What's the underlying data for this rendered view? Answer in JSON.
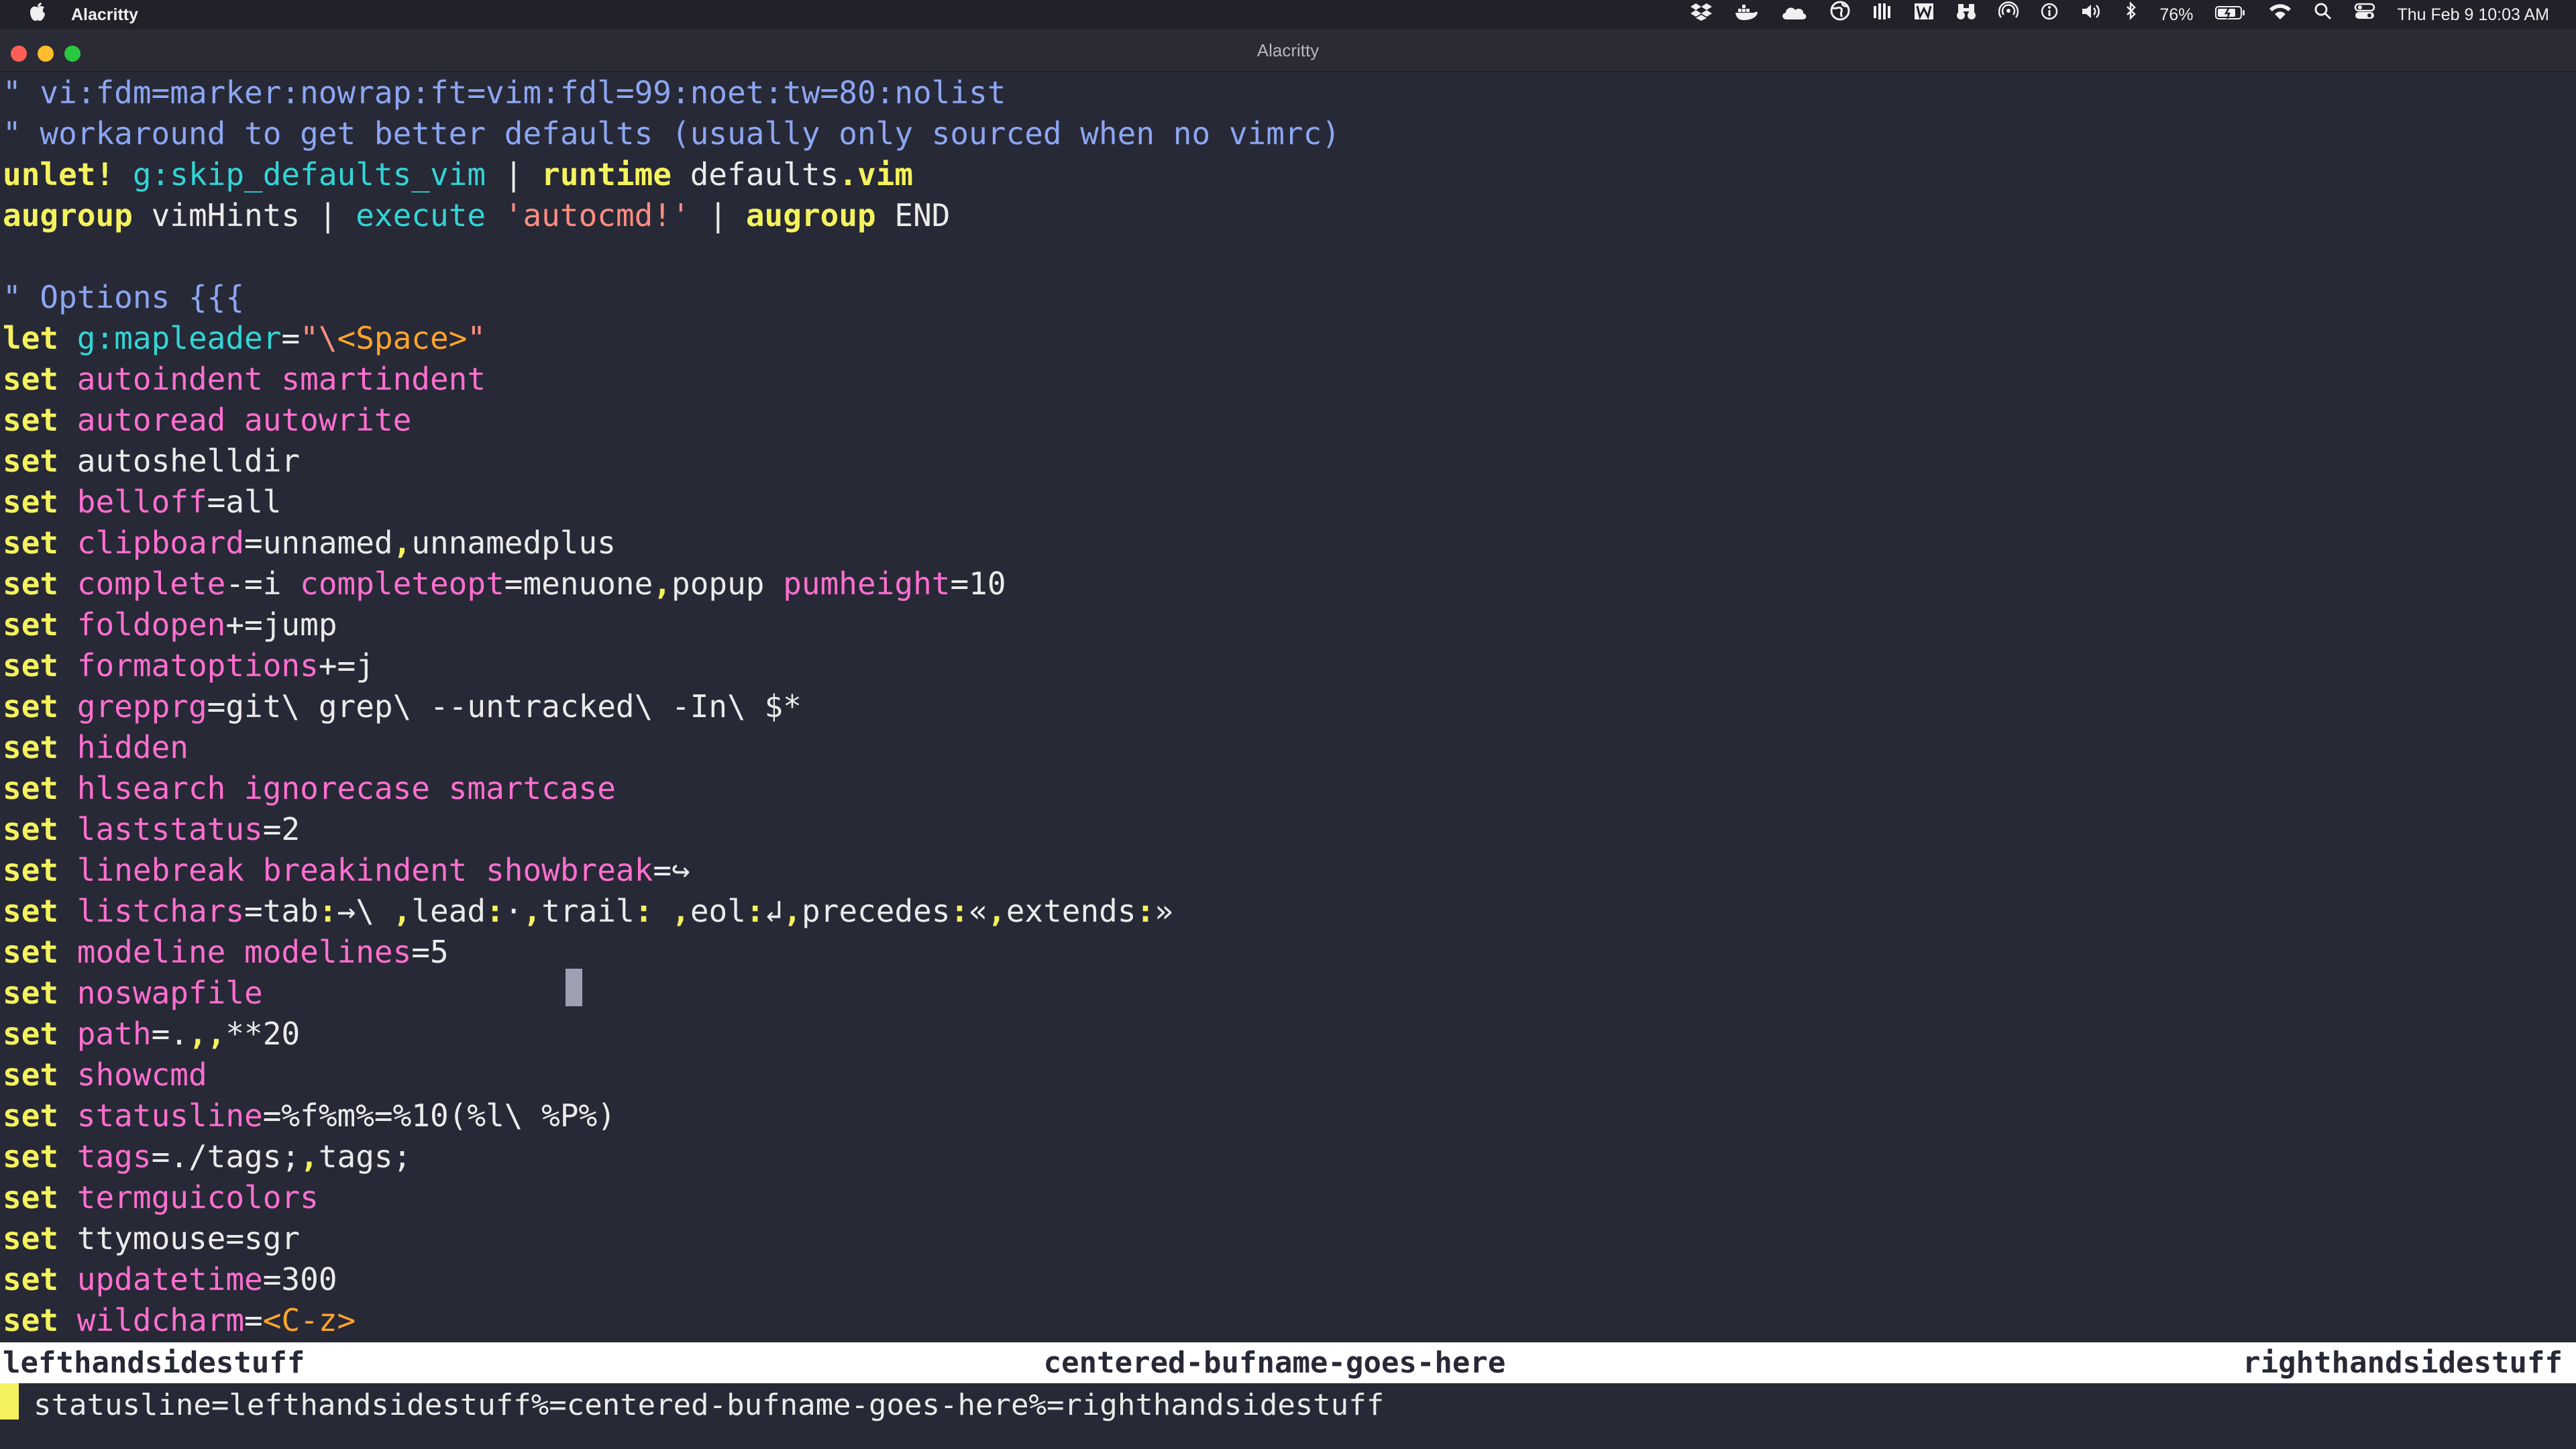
{
  "menubar": {
    "app": "Alacritty",
    "icons": [
      "apple-icon",
      "dropbox-icon",
      "docker-icon",
      "cloud-icon",
      "globe-icon",
      "bars-icon",
      "w-icon",
      "binoculars-icon",
      "airdrop-icon",
      "info-icon",
      "volume-icon",
      "bluetooth-icon",
      "battery-icon",
      "wifi-icon",
      "search-icon",
      "control-center-icon"
    ],
    "battery": "76%",
    "datetime": "Thu Feb 9  10:03 AM"
  },
  "window": {
    "title": "Alacritty"
  },
  "editor": {
    "lines": {
      "l1": "\" vi:fdm=marker:nowrap:ft=vim:fdl=99:noet:tw=80:nolist",
      "l2": "\" workaround to get better defaults (usually only sourced when no vimrc)",
      "l3": {
        "a": "unlet!",
        "b": " ",
        "c": "g:skip_defaults_vim",
        "d": " | ",
        "e": "runtime",
        "f": " defaults",
        "g": ".vim"
      },
      "l4": {
        "a": "augroup",
        "b": " vimHints | ",
        "c": "execute",
        "d": " ",
        "e": "'autocmd!'",
        "f": " | ",
        "g": "augroup",
        "h": " END"
      },
      "l6": "\" Options {{{",
      "l7": {
        "a": "let",
        "b": " ",
        "c": "g:mapleader",
        "d": "=",
        "e": "\"\\",
        "f": "<Space>",
        "g": "\""
      },
      "l8": {
        "a": "set",
        "b": " autoindent smartindent"
      },
      "l9": {
        "a": "set",
        "b": " autoread autowrite"
      },
      "l10": {
        "a": "set",
        "b": " autoshelldir"
      },
      "l11": {
        "a": "set",
        "b": " belloff",
        "c": "=all"
      },
      "l12": {
        "a": "set",
        "b": " clipboard",
        "c": "=unnamed",
        "d": ",",
        "e": "unnamedplus"
      },
      "l13": {
        "a": "set",
        "b": " complete",
        "c": "-=i ",
        "d": "completeopt",
        "e": "=menuone",
        "f": ",",
        "g": "popup ",
        "h": "pumheight",
        "i": "=10"
      },
      "l14": {
        "a": "set",
        "b": " foldopen",
        "c": "+=jump"
      },
      "l15": {
        "a": "set",
        "b": " formatoptions",
        "c": "+=j"
      },
      "l16": {
        "a": "set",
        "b": " grepprg",
        "c": "=git\\ grep\\ --untracked\\ -In\\ $*"
      },
      "l17": {
        "a": "set",
        "b": " hidden"
      },
      "l18": {
        "a": "set",
        "b": " hlsearch ignorecase smartcase"
      },
      "l19": {
        "a": "set",
        "b": " laststatus",
        "c": "=2"
      },
      "l20": {
        "a": "set",
        "b": " linebreak breakindent showbreak",
        "c": "=↪"
      },
      "l21": {
        "a": "set",
        "b": " listchars",
        "c": "=tab",
        "d": ":",
        "e": "→\\ ",
        "f": ",",
        "g": "lead",
        "h": ":",
        "i": "·",
        "j": ",",
        "k": "trail",
        "l": ":",
        "m": " ",
        "n": ",",
        "o": "eol",
        "p": ":",
        "q": "↲",
        "r": ",",
        "s": "precedes",
        "t": ":",
        "u": "«",
        "v": ",",
        "w": "extends",
        "x": ":",
        "y": "»"
      },
      "l22": {
        "a": "set",
        "b": " modeline modelines",
        "c": "=5"
      },
      "l23": {
        "a": "set",
        "b": " noswapfile"
      },
      "l24": {
        "a": "set",
        "b": " path",
        "c": "=.",
        "d": ",,",
        "e": "**20"
      },
      "l25": {
        "a": "set",
        "b": " showcmd"
      },
      "l26": {
        "a": "set",
        "b": " statusline",
        "c": "=%f%m%=%10(%l\\ %P%)"
      },
      "l27": {
        "a": "set",
        "b": " tags",
        "c": "=./tags;",
        "d": ",",
        "e": "tags;"
      },
      "l28": {
        "a": "set",
        "b": " termguicolors"
      },
      "l29": {
        "a": "set",
        "b": " ttymouse",
        "c": "=sgr"
      },
      "l30": {
        "a": "set",
        "b": " updatetime",
        "c": "=300"
      },
      "l31": {
        "a": "set",
        "b": " wildcharm",
        "c": "=",
        "d": "<C-z>"
      }
    }
  },
  "statusline": {
    "left": "lefthandsidestuff",
    "center": "centered-bufname-goes-here",
    "right": "righthandsidestuff"
  },
  "cmdline": "statusline=lefthandsidestuff%=centered-bufname-goes-here%=righthandsidestuff"
}
